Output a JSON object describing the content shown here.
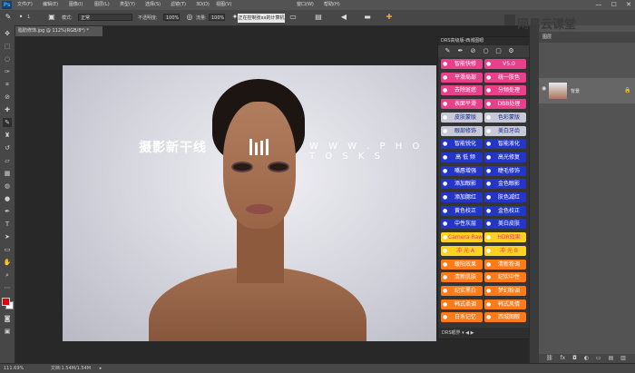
{
  "menu": [
    "文件(F)",
    "编辑(E)",
    "图像(I)",
    "图层(L)",
    "类型(Y)",
    "选择(S)",
    "滤镜(T)",
    "3D(D)",
    "视图(V)",
    "窗口(W)",
    "帮助(H)"
  ],
  "remote_status": "正在控制张xx的计算机",
  "window_controls": {
    "min": "—",
    "max": "☐",
    "close": "✕"
  },
  "options": {
    "brush_size": "1",
    "mode_label": "模式:",
    "mode_value": "正常",
    "opacity_label": "不透明度:",
    "opacity_value": "100%",
    "flow_label": "流量:",
    "flow_value": "100%"
  },
  "document_tab": "脂肪修饰.jpg @ 112%(RGB/8*) *",
  "watermark": {
    "cn": "摄影新干线",
    "en": "W W W . P H O T O S K S"
  },
  "status": {
    "zoom": "111.69%",
    "doc": "文档:1.54M/1.54M"
  },
  "plugin": {
    "title": "DRS高级版-西城图眼",
    "buttons": [
      {
        "left": "智能快修",
        "right": "V5.0",
        "style": "pink"
      },
      {
        "left": "平滑局部",
        "right": "统一肤色",
        "style": "pink"
      },
      {
        "left": "去除斑痣",
        "right": "分频处理",
        "style": "pink"
      },
      {
        "left": "表面平滑",
        "right": "DBB处理",
        "style": "pink"
      },
      {
        "left": "皮肤蒙版",
        "right": "色彩蒙版",
        "style": "gray"
      },
      {
        "left": "眼部修饰",
        "right": "美白牙齿",
        "style": "gray"
      },
      {
        "left": "智能锐化",
        "right": "智能液化",
        "style": "blue"
      },
      {
        "left": "高 低 频",
        "right": "高光修复",
        "style": "blue"
      },
      {
        "left": "嘴唇增强",
        "right": "睫毛修饰",
        "style": "blue"
      },
      {
        "left": "添加眼影",
        "right": "金色眼影",
        "style": "blue"
      },
      {
        "left": "添加腮红",
        "right": "肤色减红",
        "style": "blue"
      },
      {
        "left": "黄色校正",
        "right": "金色校正",
        "style": "blue"
      },
      {
        "left": "中性灰层",
        "right": "美白皮肤",
        "style": "blue"
      },
      {
        "left": "Camera Raw",
        "right": "HDR效果",
        "style": "yellow"
      },
      {
        "left": "冲 光 A",
        "right": "冲 光 B",
        "style": "yellow"
      },
      {
        "left": "暖阳效果",
        "right": "清新粉调",
        "style": "orange"
      },
      {
        "left": "清新肌肤",
        "right": "纪实中性",
        "style": "orange"
      },
      {
        "left": "纪实黑白",
        "right": "梦幻粉调",
        "style": "orange"
      },
      {
        "left": "韩式柔调",
        "right": "韩式风情",
        "style": "orange"
      },
      {
        "left": "日系记忆",
        "right": "西城图眼",
        "style": "orange"
      }
    ],
    "footer": "DRS眼界 ▾ ◀ ▶"
  },
  "layers_panel": {
    "tab": "图层",
    "layer_name": "背景",
    "lock": "🔒"
  },
  "brand": "网易云课堂"
}
